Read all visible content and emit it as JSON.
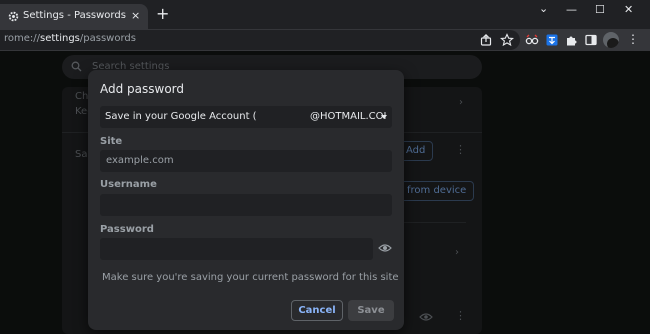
{
  "tab": {
    "title": "Settings - Passwords",
    "close_glyph": "×"
  },
  "new_tab_glyph": "+",
  "window_controls": {
    "chevron": "⌄",
    "minimize": "—",
    "maximize": "☐",
    "close": "✕"
  },
  "omnibox": {
    "url_prefix": "rome://",
    "url_host": "settings",
    "url_path": "/passwords"
  },
  "toolbar_icons": [
    "share-icon",
    "bookmark-star-icon",
    "extension-glasses-icon",
    "extension-translate-icon",
    "extensions-puzzle-icon",
    "side-panel-icon",
    "profile-avatar-icon",
    "menu-dots-icon"
  ],
  "menu_glyph": "⋮",
  "background": {
    "search_placeholder": "Search settings",
    "row1_text": "Che",
    "row1_sub": "Kee",
    "row2_text": "Sav",
    "add_button": "Add",
    "import_button": "from device",
    "dots": "⋮",
    "chevron": "›"
  },
  "dialog": {
    "title": "Add password",
    "account_prefix": "Save in your Google Account (",
    "account_suffix": "@HOTMAIL.COI",
    "site_label": "Site",
    "site_placeholder": "example.com",
    "username_label": "Username",
    "username_value": "",
    "password_label": "Password",
    "password_value": "",
    "hint": "Make sure you're saving your current password for this site",
    "cancel_label": "Cancel",
    "save_label": "Save"
  },
  "colors": {
    "accent": "#8ab4f8",
    "dialog_bg": "#292a2d",
    "field_bg": "#202124",
    "toolbar_bg": "#35363a",
    "tabstrip_bg": "#202124"
  }
}
